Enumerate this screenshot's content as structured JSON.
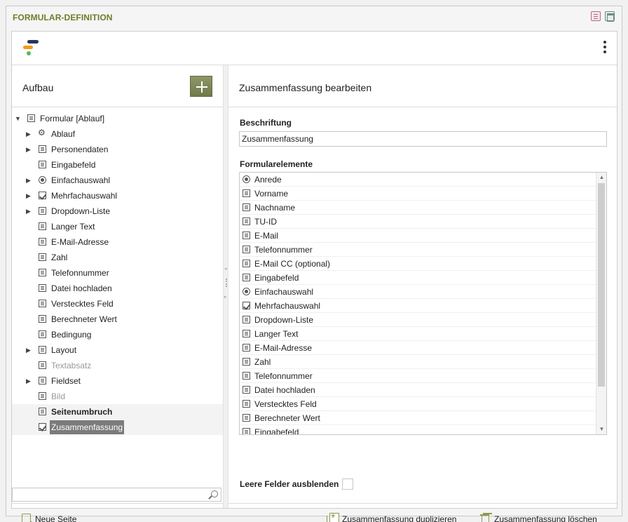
{
  "window": {
    "title": "FORMULAR-DEFINITION"
  },
  "left_panel": {
    "title": "Aufbau",
    "tree": [
      {
        "label": "Formular [Ablauf]",
        "icon": "form-icon",
        "level": 0,
        "arrow": "down"
      },
      {
        "label": "Ablauf",
        "icon": "gear-icon",
        "level": 1,
        "arrow": "right"
      },
      {
        "label": "Personendaten",
        "icon": "table-icon",
        "level": 1,
        "arrow": "right"
      },
      {
        "label": "Eingabefeld",
        "icon": "textfield-icon",
        "level": 1,
        "arrow": ""
      },
      {
        "label": "Einfachauswahl",
        "icon": "radio-icon",
        "level": 1,
        "arrow": "right"
      },
      {
        "label": "Mehrfachauswahl",
        "icon": "checkbox-icon",
        "level": 1,
        "arrow": "right"
      },
      {
        "label": "Dropdown-Liste",
        "icon": "dropdown-icon",
        "level": 1,
        "arrow": "right"
      },
      {
        "label": "Langer Text",
        "icon": "textarea-icon",
        "level": 1,
        "arrow": ""
      },
      {
        "label": "E-Mail-Adresse",
        "icon": "email-icon",
        "level": 1,
        "arrow": ""
      },
      {
        "label": "Zahl",
        "icon": "number-icon",
        "level": 1,
        "arrow": ""
      },
      {
        "label": "Telefonnummer",
        "icon": "phone-icon",
        "level": 1,
        "arrow": ""
      },
      {
        "label": "Datei hochladen",
        "icon": "upload-icon",
        "level": 1,
        "arrow": ""
      },
      {
        "label": "Verstecktes Feld",
        "icon": "hidden-field-icon",
        "level": 1,
        "arrow": ""
      },
      {
        "label": "Berechneter Wert",
        "icon": "calculator-icon",
        "level": 1,
        "arrow": ""
      },
      {
        "label": "Bedingung",
        "icon": "condition-icon",
        "level": 1,
        "arrow": ""
      },
      {
        "label": "Layout",
        "icon": "layout-icon",
        "level": 1,
        "arrow": "right"
      },
      {
        "label": "Textabsatz",
        "icon": "paragraph-icon",
        "level": 1,
        "arrow": "",
        "muted": true
      },
      {
        "label": "Fieldset",
        "icon": "fieldset-icon",
        "level": 1,
        "arrow": "right"
      },
      {
        "label": "Bild",
        "icon": "image-icon",
        "level": 1,
        "arrow": "",
        "muted": true
      },
      {
        "label": "Seitenumbruch",
        "icon": "page-break-icon",
        "level": 1,
        "arrow": "",
        "bold": true
      },
      {
        "label": "Zusammenfassung",
        "icon": "summary-icon",
        "level": 1,
        "arrow": "",
        "selected": true
      }
    ],
    "search_placeholder": "",
    "new_page_label": "Neue Seite"
  },
  "right_panel": {
    "title": "Zusammenfassung bearbeiten",
    "caption_label": "Beschriftung",
    "caption_value": "Zusammenfassung",
    "elements_label": "Formularelemente",
    "elements": [
      {
        "label": "Anrede",
        "icon": "radio-icon"
      },
      {
        "label": "Vorname",
        "icon": "textfield-icon"
      },
      {
        "label": "Nachname",
        "icon": "textfield-icon"
      },
      {
        "label": "TU-ID",
        "icon": "textfield-icon"
      },
      {
        "label": "E-Mail",
        "icon": "email-icon"
      },
      {
        "label": "Telefonnummer",
        "icon": "phone-icon"
      },
      {
        "label": "E-Mail CC (optional)",
        "icon": "email-icon"
      },
      {
        "label": "Eingabefeld",
        "icon": "textfield-icon"
      },
      {
        "label": "Einfachauswahl",
        "icon": "radio-icon"
      },
      {
        "label": "Mehrfachauswahl",
        "icon": "checkbox-icon"
      },
      {
        "label": "Dropdown-Liste",
        "icon": "dropdown-icon"
      },
      {
        "label": "Langer Text",
        "icon": "textarea-icon"
      },
      {
        "label": "E-Mail-Adresse",
        "icon": "email-icon"
      },
      {
        "label": "Zahl",
        "icon": "number-icon"
      },
      {
        "label": "Telefonnummer",
        "icon": "phone-icon"
      },
      {
        "label": "Datei hochladen",
        "icon": "upload-icon"
      },
      {
        "label": "Verstecktes Feld",
        "icon": "hidden-field-icon"
      },
      {
        "label": "Berechneter Wert",
        "icon": "calculator-icon"
      },
      {
        "label": "Eingabefeld",
        "icon": "textfield-icon"
      }
    ],
    "hide_empty_label": "Leere Felder ausblenden",
    "hide_empty_checked": false,
    "duplicate_label": "Zusammenfassung duplizieren",
    "delete_label": "Zusammenfassung löschen"
  },
  "colors": {
    "accent": "#6b7d2a",
    "button": "#7a8456",
    "icon_green": "#8c9b4f",
    "selection": "#7b7b7b"
  }
}
